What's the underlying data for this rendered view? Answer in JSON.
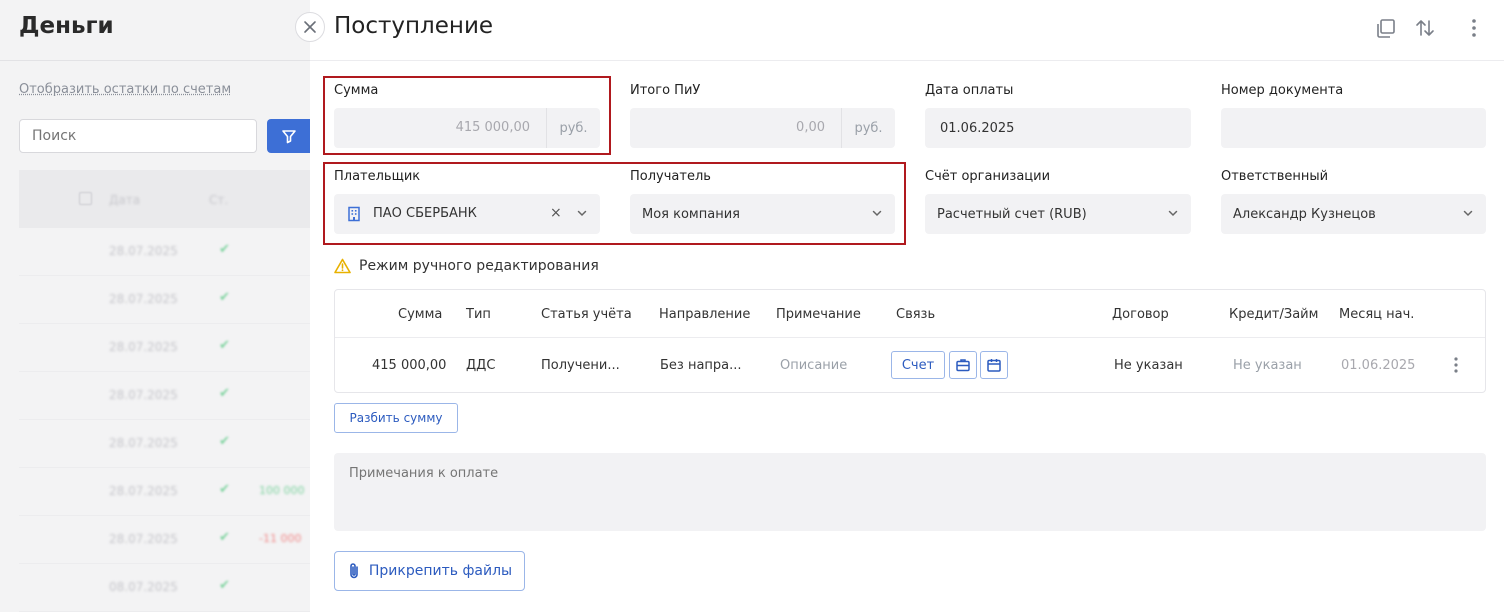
{
  "background": {
    "title": "Деньги",
    "link": "Отобразить остатки по счетам",
    "search_placeholder": "Поиск",
    "table_headers": [
      "Дата",
      "Ст."
    ],
    "rows": [
      {
        "date": "28.07.2025",
        "amount": "",
        "amount_color": ""
      },
      {
        "date": "28.07.2025",
        "amount": "",
        "amount_color": ""
      },
      {
        "date": "28.07.2025",
        "amount": "",
        "amount_color": ""
      },
      {
        "date": "28.07.2025",
        "amount": "",
        "amount_color": ""
      },
      {
        "date": "28.07.2025",
        "amount": "",
        "amount_color": ""
      },
      {
        "date": "28.07.2025",
        "amount": "100 000",
        "amount_color": "#7fd3a0"
      },
      {
        "date": "28.07.2025",
        "amount": "-11 000",
        "amount_color": "#f08a8a"
      },
      {
        "date": "08.07.2025",
        "amount": "",
        "amount_color": ""
      }
    ]
  },
  "panel": {
    "title": "Поступление",
    "fields": {
      "sum": {
        "label": "Сумма",
        "value": "415 000,00",
        "unit": "руб."
      },
      "total_piu": {
        "label": "Итого ПиУ",
        "value": "0,00",
        "unit": "руб."
      },
      "pay_date": {
        "label": "Дата оплаты",
        "value": "01.06.2025"
      },
      "doc_number": {
        "label": "Номер документа",
        "value": ""
      },
      "payer": {
        "label": "Плательщик",
        "value": "ПАО СБЕРБАНК",
        "clear": "×"
      },
      "recipient": {
        "label": "Получатель",
        "value": "Моя компания"
      },
      "org_account": {
        "label": "Счёт организации",
        "value": "Расчетный счет (RUB)"
      },
      "responsible": {
        "label": "Ответственный",
        "value": "Александр Кузнецов"
      }
    },
    "warning": "Режим ручного редактирования",
    "table": {
      "headers": [
        "Сумма",
        "Тип",
        "Статья учёта",
        "Направление",
        "Примечание",
        "Связь",
        "Договор",
        "Кредит/Займ",
        "Месяц нач."
      ],
      "row": {
        "sum": "415 000,00",
        "type": "ДДС",
        "article": "Получени...",
        "direction": "Без напра...",
        "note": "Описание",
        "link_button": "Счет",
        "contract": "Не указан",
        "credit": "Не указан",
        "month": "01.06.2025"
      }
    },
    "split_button": "Разбить сумму",
    "notes_placeholder": "Примечания к оплате",
    "attach_button": "Прикрепить файлы"
  },
  "colors": {
    "accent": "#3d6fd6",
    "highlight": "#b0191e",
    "warning": "#e8b100"
  }
}
